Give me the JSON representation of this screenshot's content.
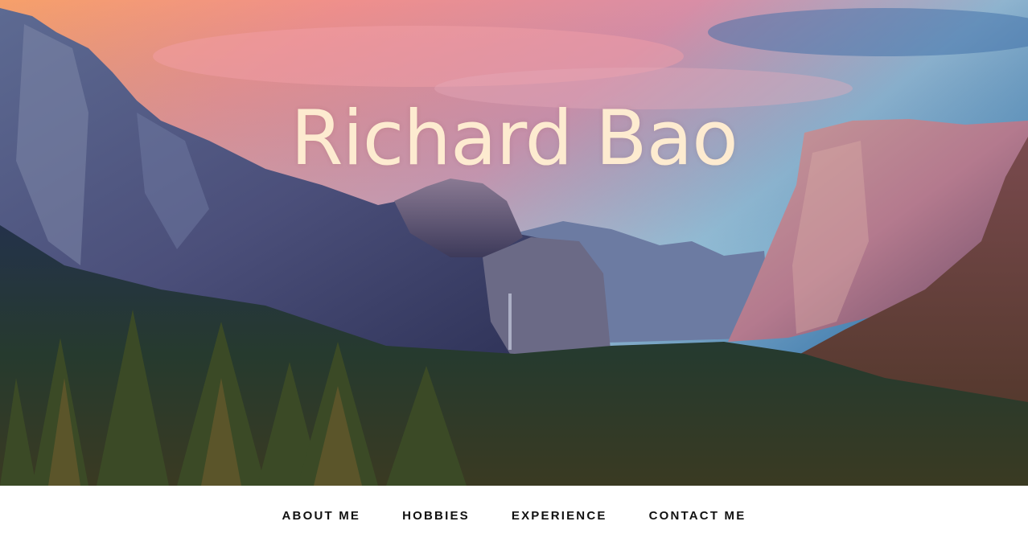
{
  "hero": {
    "title": "Richard Bao"
  },
  "nav": {
    "items": [
      {
        "label": "ABOUT ME"
      },
      {
        "label": "HOBBIES"
      },
      {
        "label": "EXPERIENCE"
      },
      {
        "label": "CONTACT ME"
      }
    ]
  },
  "colors": {
    "title": "#fdebd0",
    "nav_text": "#111111",
    "nav_background": "#ffffff"
  }
}
